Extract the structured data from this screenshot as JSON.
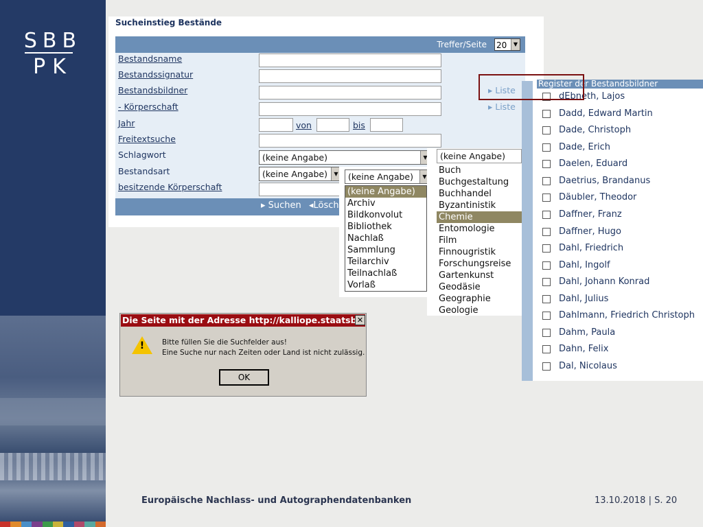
{
  "logo": {
    "line1": "SBB",
    "line2": "PK"
  },
  "form": {
    "title": "Sucheinstieg Bestände",
    "hits_label": "Treffer/Seite",
    "hits_value": "20",
    "fields": [
      {
        "label": "Bestandsname"
      },
      {
        "label": "Bestandssignatur"
      },
      {
        "label": "Bestandsbildner",
        "liste": "Liste"
      },
      {
        "label": "- Körperschaft",
        "liste": "Liste"
      },
      {
        "label": "Jahr"
      },
      {
        "label": "Freitextsuche"
      },
      {
        "label": "Schlagwort"
      },
      {
        "label": "Bestandsart"
      },
      {
        "label": "besitzende Körperschaft"
      }
    ],
    "year_from": "von",
    "year_to": "bis",
    "schlagwort_value": "(keine Angabe)",
    "bestandsart_value": "(keine Angabe)",
    "second_combo_value": "(keine Angabe)",
    "search_button": "Suchen",
    "clear_button": "Lösch"
  },
  "dropdown_bestandsart": {
    "items": [
      "(keine Angabe)",
      "Archiv",
      "Bildkonvolut",
      "Bibliothek",
      "Nachlaß",
      "Sammlung",
      "Teilarchiv",
      "Teilnachlaß",
      "Vorlaß"
    ],
    "selected": 0
  },
  "dropdown_schlagwort": {
    "value": "(keine Angabe)",
    "items": [
      "Buch",
      "Buchgestaltung",
      "Buchhandel",
      "Byzantinistik",
      "Chemie",
      "Entomologie",
      "Film",
      "Finnougristik",
      "Forschungsreise",
      "Gartenkunst",
      "Geodäsie",
      "Geographie",
      "Geologie"
    ],
    "selected": 4
  },
  "register": {
    "title": "Register der Bestandsbildner",
    "items": [
      "dEbneth, Lajos",
      "Dadd, Edward Martin",
      "Dade, Christoph",
      "Dade, Erich",
      "Daelen, Eduard",
      "Daetrius, Brandanus",
      "Däubler, Theodor",
      "Daffner, Franz",
      "Daffner, Hugo",
      "Dahl, Friedrich",
      "Dahl, Ingolf",
      "Dahl, Johann Konrad",
      "Dahl, Julius",
      "Dahlmann, Friedrich Christoph",
      "Dahm, Paula",
      "Dahn, Felix",
      "Dal, Nicolaus"
    ]
  },
  "dialog": {
    "title": "Die Seite mit der Adresse http://kalliope.staatsbi...",
    "close": "✕",
    "line1": "Bitte füllen Sie die Suchfelder aus!",
    "line2": "Eine Suche nur nach Zeiten oder Land ist nicht zulässig.",
    "ok": "OK"
  },
  "footer": {
    "left": "Europäische Nachlass- und Autographendatenbanken",
    "right": "13.10.2018 | S. 20"
  },
  "colors": {
    "navy": "#243a66",
    "bar": "#6b8fb7",
    "dialog_title": "#9a0d12",
    "highlight": "#8f8762",
    "annotation": "#7a1010"
  }
}
